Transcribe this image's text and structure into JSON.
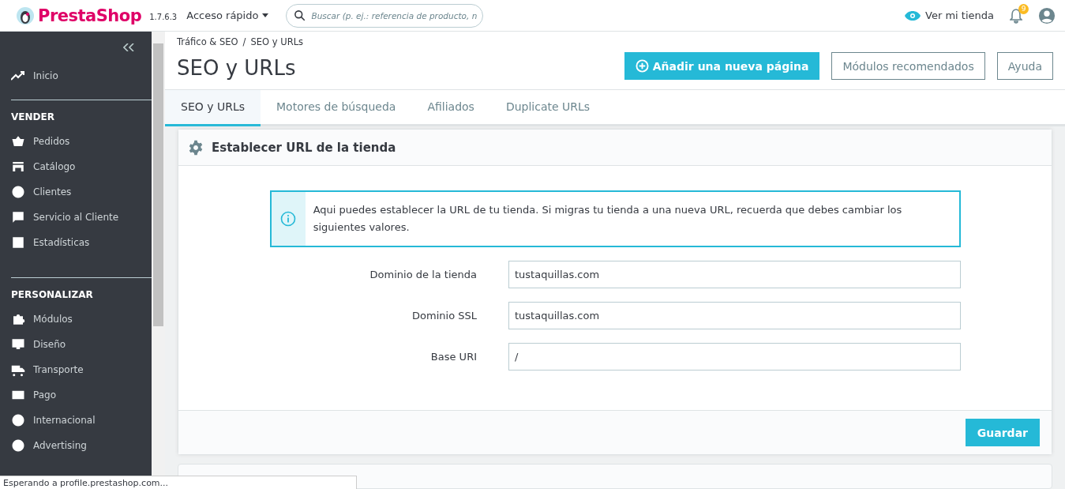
{
  "header": {
    "logo": "PrestaShop",
    "version": "1.7.6.3",
    "quick_access": "Acceso rápido",
    "search": {
      "placeholder": "Buscar (p. ej.: referencia de producto, n"
    },
    "view_store": "Ver mi tienda",
    "notification_count": "9"
  },
  "sidebar": {
    "home": {
      "label": "Inicio"
    },
    "sections": [
      {
        "title": "VENDER",
        "items": [
          {
            "label": "Pedidos"
          },
          {
            "label": "Catálogo"
          },
          {
            "label": "Clientes"
          },
          {
            "label": "Servicio al Cliente"
          },
          {
            "label": "Estadísticas"
          }
        ]
      },
      {
        "title": "PERSONALIZAR",
        "items": [
          {
            "label": "Módulos"
          },
          {
            "label": "Diseño"
          },
          {
            "label": "Transporte"
          },
          {
            "label": "Pago"
          },
          {
            "label": "Internacional"
          },
          {
            "label": "Advertising"
          }
        ]
      }
    ]
  },
  "breadcrumb": [
    "Tráfico & SEO",
    "SEO y URLs"
  ],
  "breadcrumb_separator": "/",
  "page_title": "SEO y URLs",
  "toolbar": [
    {
      "label": "Añadir una nueva página",
      "kind": "primary"
    },
    {
      "label": "Módulos recomendados",
      "kind": "outline"
    },
    {
      "label": "Ayuda",
      "kind": "outline"
    }
  ],
  "tabs": [
    {
      "label": "SEO y URLs",
      "selected": true
    },
    {
      "label": "Motores de búsqueda",
      "selected": false
    },
    {
      "label": "Afiliados",
      "selected": false
    },
    {
      "label": "Duplicate URLs",
      "selected": false
    }
  ],
  "panel": {
    "title": "Establecer URL de la tienda",
    "alert": "Aqui puedes establecer la URL de tu tienda. Si migras tu tienda a una nueva URL, recuerda que debes cambiar los siguientes valores.",
    "fields": [
      {
        "label": "Dominio de la tienda",
        "value": "tustaquillas.com"
      },
      {
        "label": "Dominio SSL",
        "value": "tustaquillas.com"
      },
      {
        "label": "Base URI",
        "value": "/"
      }
    ],
    "save": "Guardar"
  },
  "status_bar": "Esperando a profile.prestashop.com..."
}
